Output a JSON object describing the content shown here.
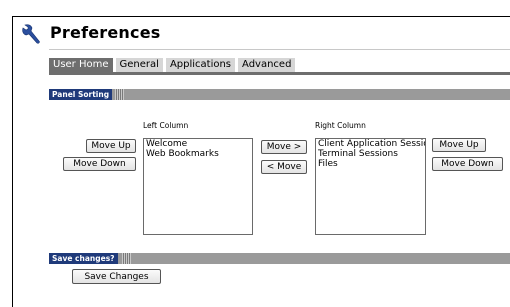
{
  "header": {
    "title": "Preferences",
    "icon": "wrench-icon"
  },
  "tabs": [
    {
      "label": "User Home",
      "active": true
    },
    {
      "label": "General",
      "active": false
    },
    {
      "label": "Applications",
      "active": false
    },
    {
      "label": "Advanced",
      "active": false
    }
  ],
  "panel_sorting": {
    "heading": "Panel Sorting",
    "left_column": {
      "label": "Left Column",
      "items": [
        "Welcome",
        "Web Bookmarks"
      ],
      "move_up": "Move Up",
      "move_down": "Move Down"
    },
    "move_right": "Move >",
    "move_left": "< Move",
    "right_column": {
      "label": "Right Column",
      "items": [
        "Client Application Sessions",
        "Terminal Sessions",
        "Files"
      ],
      "move_up": "Move Up",
      "move_down": "Move Down"
    }
  },
  "save": {
    "heading": "Save changes?",
    "button": "Save Changes"
  },
  "colors": {
    "section_label": "#1f3a7a",
    "active_tab": "#6e6e6e",
    "inactive_tab": "#d6d6d6"
  }
}
